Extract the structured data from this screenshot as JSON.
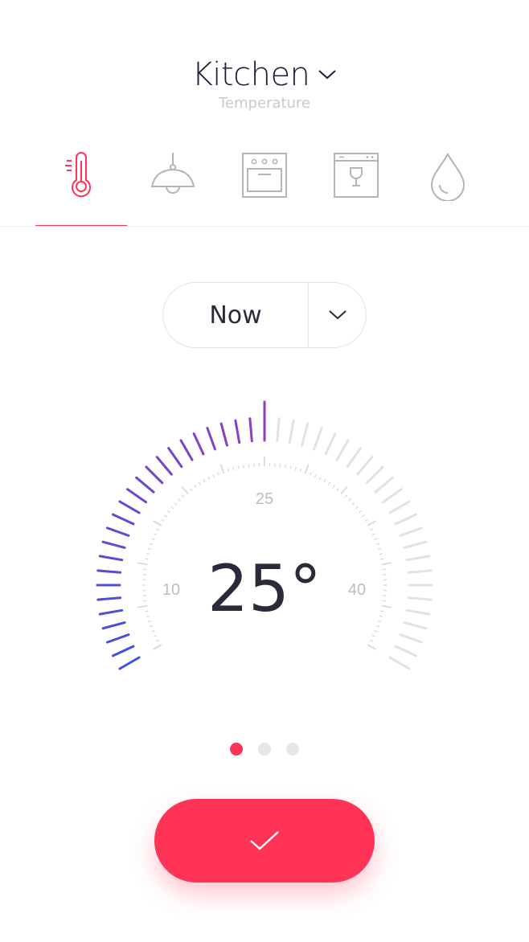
{
  "header": {
    "room": "Kitchen",
    "subtitle": "Temperature"
  },
  "tabs": [
    {
      "name": "Temperature",
      "icon": "thermometer-icon",
      "active": true
    },
    {
      "name": "Lighting",
      "icon": "ceiling-lamp-icon",
      "active": false
    },
    {
      "name": "Oven",
      "icon": "oven-icon",
      "active": false
    },
    {
      "name": "Dishwasher",
      "icon": "dishwasher-icon",
      "active": false
    },
    {
      "name": "Water",
      "icon": "water-drop-icon",
      "active": false
    }
  ],
  "time_select": {
    "value": "Now"
  },
  "dial": {
    "value_label": "25°",
    "min": 0,
    "max": 50,
    "value": 25,
    "scale_labels": [
      "10",
      "25",
      "40"
    ]
  },
  "pager": {
    "count": 3,
    "active": 0
  },
  "colors": {
    "accent": "#ff3355",
    "gradient_start": "#3f51e0",
    "gradient_mid": "#8e3fc2",
    "gradient_end": "#ff2f5c",
    "inactive_tick": "#e2e2e2",
    "icon_inactive": "#b4b4b8",
    "text_dark": "#2a2a3a"
  }
}
